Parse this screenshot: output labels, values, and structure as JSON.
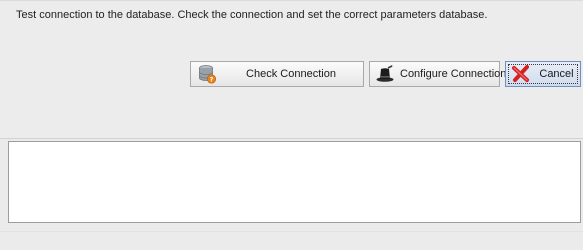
{
  "message": "Test connection to the database. Check the connection and set the correct parameters database.",
  "buttons": {
    "check_connection": "Check Connection",
    "configure_connection": "Configure Connection",
    "cancel": "Cancel"
  },
  "log": {
    "text": ""
  },
  "colors": {
    "background": "#ebebeb",
    "button_focus_border": "#6e8fbf",
    "cancel_icon": "#d62020",
    "database_icon": "#8a8f96",
    "database_icon_badge": "#e8841a"
  },
  "icons": {
    "check_connection": "database-check-icon",
    "configure_connection": "magic-hat-icon",
    "cancel": "red-x-icon"
  }
}
